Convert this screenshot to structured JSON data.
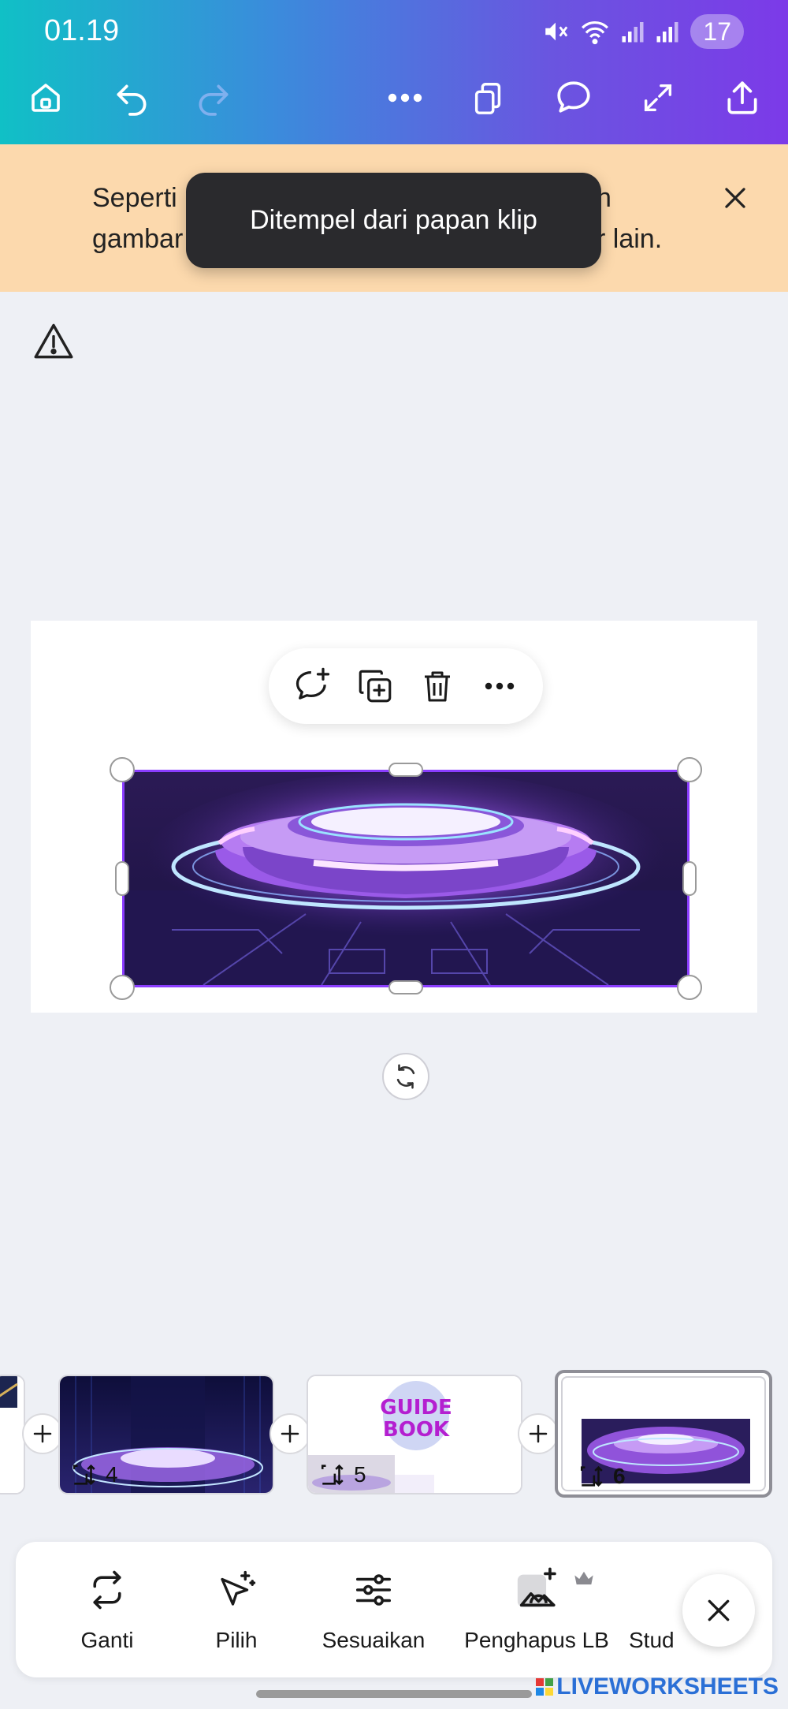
{
  "status_bar": {
    "time": "01.19",
    "battery": "17"
  },
  "banner": {
    "text_line1": "Seperti",
    "text_line1_end": "n",
    "text_line2": "gambar",
    "text_line2_end": "r lain."
  },
  "toast": {
    "message": "Ditempel dari papan klip"
  },
  "pages": [
    {
      "number": "4"
    },
    {
      "number": "5",
      "title": "GUIDE BOOK"
    },
    {
      "number": "6"
    }
  ],
  "tools": [
    {
      "label": "Ganti",
      "icon": "replace-icon"
    },
    {
      "label": "Pilih",
      "icon": "magic-select-icon"
    },
    {
      "label": "Sesuaikan",
      "icon": "adjust-icon"
    },
    {
      "label": "Penghapus LB",
      "icon": "bg-remover-icon"
    },
    {
      "label": "Stud",
      "icon": "studio-icon"
    }
  ],
  "watermark": {
    "text": "LIVEWORKSHEETS"
  },
  "colors": {
    "selection": "#8b3dff",
    "banner": "#fcd9ad",
    "toast": "#2a2a2d"
  }
}
